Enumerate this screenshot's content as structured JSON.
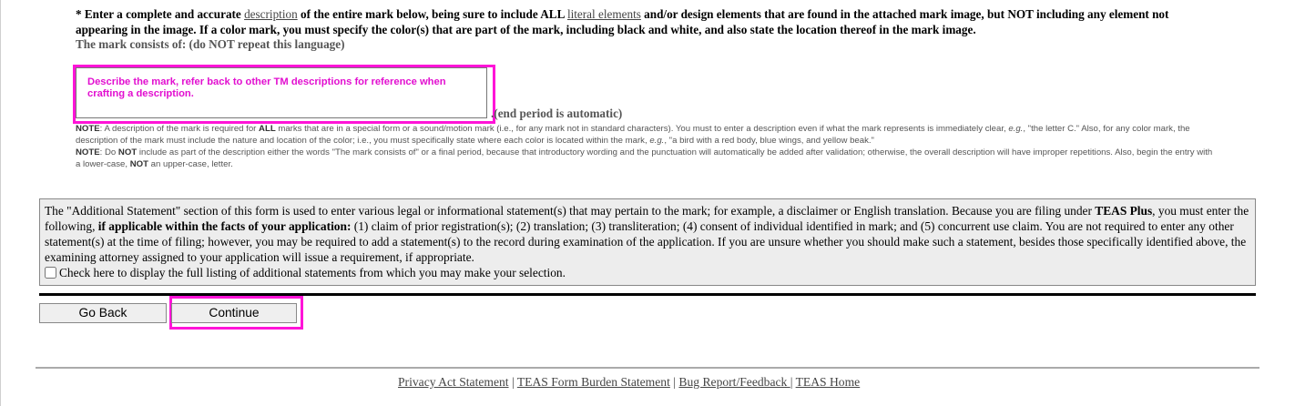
{
  "instructions": {
    "prefix": "* Enter a complete and accurate ",
    "link_description": "description",
    "mid": " of the entire mark below, being sure to include ALL ",
    "link_literal": "literal elements",
    "suffix": " and/or design elements that are found in the attached mark image, but NOT including any element not appearing in the image. If a color mark, you must specify the color(s) that are part of the mark, including black and white, and also state the location thereof in the mark image.",
    "consists_label": "The mark consists of: (do NOT repeat this language)"
  },
  "description_field": {
    "value": "Describe the mark, refer back to other TM descriptions for reference when crafting a description.",
    "end_period_label": ".(end period is automatic)"
  },
  "note": {
    "label1": "NOTE",
    "text1a": ": A description of the mark is required for ",
    "all": "ALL",
    "text1b": " marks that are in a special form or a sound/motion mark (i.e., for any mark not in standard characters). You must to enter a description even if what the mark represents is immediately clear, ",
    "eg1": "e.g.",
    "text1c": ", \"the letter C.\" Also, for any color mark, the description of the mark must include the nature and location of the color; i.e., you must specifically state where each color is located within the mark, ",
    "eg2": "e.g.",
    "text1d": ", \"a bird with a red body, blue wings, and yellow beak.\"",
    "label2": "NOTE",
    "text2a": ": Do ",
    "not1": "NOT",
    "text2b": " include as part of the description either the words \"The mark consists of\" or a final period, because that introductory wording and the punctuation will automatically be added after validation; otherwise, the overall description will have improper repetitions. Also, begin the entry with a lower-case, ",
    "not2": "NOT",
    "text2c": " an upper-case, letter."
  },
  "additional": {
    "t1": "The \"Additional Statement\" section of this form is used to enter various legal or informational statement(s) that may pertain to the mark; for example, a disclaimer or English translation. Because you are filing under ",
    "teas_plus": "TEAS Plus",
    "t2": ", you must enter the following, ",
    "bold2": "if applicable within the facts of your application:",
    "t3": " (1) claim of prior registration(s); (2) translation; (3) transliteration; (4) consent of individual identified in mark; and (5) concurrent use claim. You are not required to enter any other statement(s) at the time of filing; however, you may be required to add a statement(s) to the record during examination of the application. If you are unsure whether you should make such a statement, besides those specifically identified above, the examining attorney assigned to your application will issue a requirement, if appropriate.",
    "checkbox_label": "Check here to display the full listing of additional statements from which you may make your selection."
  },
  "buttons": {
    "back": "Go Back",
    "continue": "Continue"
  },
  "footer": {
    "privacy": "Privacy Act Statement",
    "burden": "TEAS Form Burden Statement",
    "bug": "Bug Report/Feedback ",
    "home": "TEAS Home",
    "sep": " | "
  },
  "colors": {
    "highlight": "#ff14d8",
    "hint_text": "#e20fd0"
  }
}
